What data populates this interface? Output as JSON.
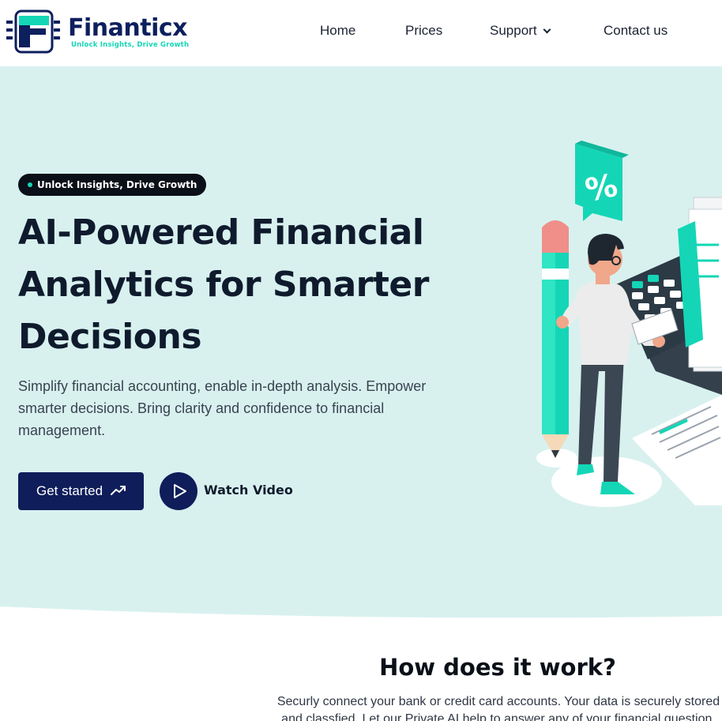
{
  "brand": {
    "name": "Finanticx",
    "tagline": "Unlock Insights, Drive Growth",
    "colors": {
      "navy": "#0f1d5a",
      "teal": "#14d6b6",
      "hero_bg": "#d8f1ef"
    }
  },
  "nav": {
    "items": [
      {
        "label": "Home"
      },
      {
        "label": "Prices"
      },
      {
        "label": "Support",
        "icon": "chevron-down-icon"
      },
      {
        "label": "Contact us"
      }
    ]
  },
  "hero": {
    "badge": "Unlock Insights, Drive Growth",
    "title": "AI-Powered Financial Analytics for Smarter Decisions",
    "subtitle": "Simplify financial accounting, enable in-depth analysis. Empower smarter decisions. Bring clarity and confidence to financial management.",
    "cta_primary": "Get started",
    "cta_secondary": "Watch Video",
    "illustration_icon": "percent-icon"
  },
  "how": {
    "title": "How does it work?",
    "text": "Securly connect your bank or credit card accounts. Your data is securely stored and classfied. Let our Private AI help to answer any of your financial question."
  }
}
